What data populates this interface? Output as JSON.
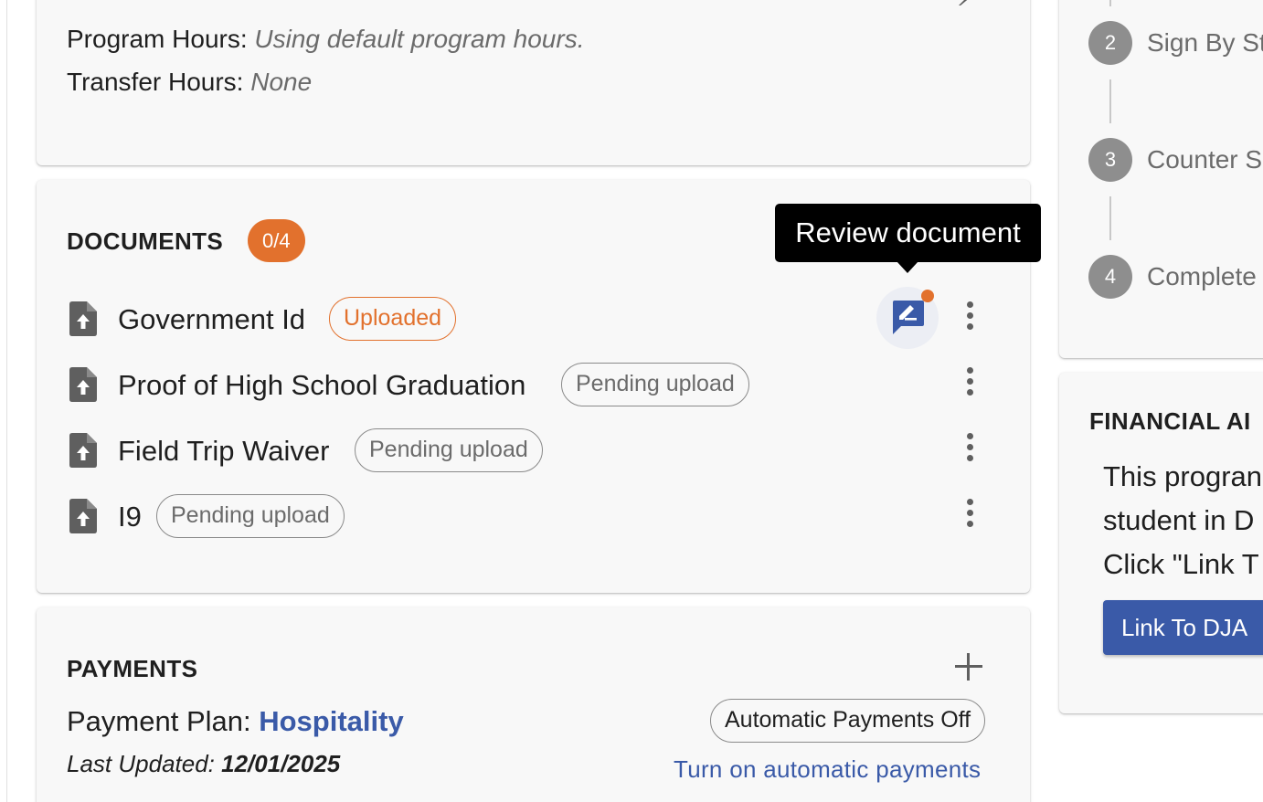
{
  "hours": {
    "program_hours_label": "Program Hours:",
    "program_hours_value": "Using default program hours.",
    "transfer_hours_label": "Transfer Hours:",
    "transfer_hours_value": "None"
  },
  "documents": {
    "title": "DOCUMENTS",
    "count_badge": "0/4",
    "tooltip": "Review document",
    "items": [
      {
        "name": "Government Id",
        "status": "Uploaded"
      },
      {
        "name": "Proof of High School Graduation",
        "status": "Pending upload"
      },
      {
        "name": "Field Trip Waiver",
        "status": "Pending upload"
      },
      {
        "name": "I9",
        "status": "Pending upload"
      }
    ]
  },
  "payments": {
    "title": "PAYMENTS",
    "plan_label": "Payment Plan:",
    "plan_name": "Hospitality",
    "last_updated_label": "Last Updated:",
    "last_updated_value": "12/01/2025",
    "auto_status": "Automatic Payments Off",
    "auto_link": "Turn on automatic payments"
  },
  "steps": [
    {
      "number": "2",
      "label": "Sign By St"
    },
    {
      "number": "3",
      "label": "Counter S"
    },
    {
      "number": "4",
      "label": "Complete"
    }
  ],
  "financial_aid": {
    "title": "FINANCIAL AI",
    "lines": [
      "This progran",
      "student in D",
      "Click \"Link T"
    ],
    "button_label": "Link To DJA"
  },
  "colors": {
    "accent_orange": "#e2712d",
    "link_blue": "#3a5aa8",
    "tooltip_bg": "#000000"
  },
  "icons": {
    "document": "file-upload-icon",
    "review": "rate-review-icon",
    "menu": "more-vert-icon",
    "add": "plus-icon"
  }
}
